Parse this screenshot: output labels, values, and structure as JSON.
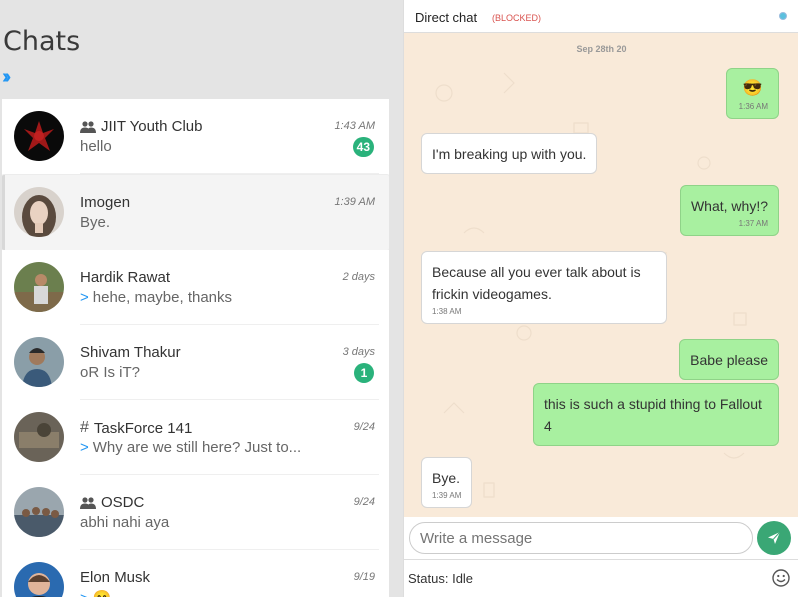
{
  "left": {
    "title": "Chats",
    "chats": [
      {
        "name": "JIIT Youth Club",
        "kind": "group",
        "message": "hello",
        "forwarded": false,
        "time": "1:43 AM",
        "unread": "43"
      },
      {
        "name": "Imogen",
        "kind": "person",
        "message": "Bye.",
        "forwarded": false,
        "time": "1:39 AM",
        "unread": ""
      },
      {
        "name": "Hardik Rawat",
        "kind": "person",
        "message": "hehe, maybe, thanks",
        "forwarded": true,
        "time": "2 days",
        "unread": ""
      },
      {
        "name": "Shivam Thakur",
        "kind": "person",
        "message": "oR Is iT?",
        "forwarded": false,
        "time": "3 days",
        "unread": "1"
      },
      {
        "name": "TaskForce 141",
        "kind": "channel",
        "message": "Why are we still here? Just to...",
        "forwarded": true,
        "time": "9/24",
        "unread": ""
      },
      {
        "name": "OSDC",
        "kind": "group",
        "message": "abhi nahi aya",
        "forwarded": false,
        "time": "9/24",
        "unread": ""
      },
      {
        "name": "Elon Musk",
        "kind": "person",
        "message": "😊",
        "forwarded": true,
        "time": "9/19",
        "unread": ""
      }
    ],
    "forward_glyph": ">",
    "channel_glyph": "#"
  },
  "conversation": {
    "title": "Direct chat",
    "blocked_label": "(BLOCKED)",
    "date": "Sep 28th 20",
    "messages": [
      {
        "text": "😎",
        "time": "1:36 AM",
        "mine": true
      },
      {
        "text": "I'm breaking up with you.",
        "time": "",
        "mine": false
      },
      {
        "text": "What, why!?",
        "time": "1:37 AM",
        "mine": true
      },
      {
        "text": "Because all you ever talk about is frickin videogames.",
        "time": "1:38 AM",
        "mine": false
      },
      {
        "text": "Babe please",
        "time": "",
        "mine": true
      },
      {
        "text": "this is such a stupid thing to Fallout 4",
        "time": "",
        "mine": true
      },
      {
        "text": "Bye.",
        "time": "1:39 AM",
        "mine": false
      }
    ],
    "input_placeholder": "Write a message",
    "status": "Status: Idle"
  },
  "colors": {
    "accent": "#2196f3",
    "badge": "#2ab27b",
    "my_bubble": "#a8f0a0",
    "chat_bg": "#f9ead9",
    "blocked": "#d9534f"
  },
  "icons": {
    "collapse": "chevron-double-right-icon",
    "group": "group-icon",
    "send": "send-icon",
    "emoji": "emoji-icon"
  }
}
